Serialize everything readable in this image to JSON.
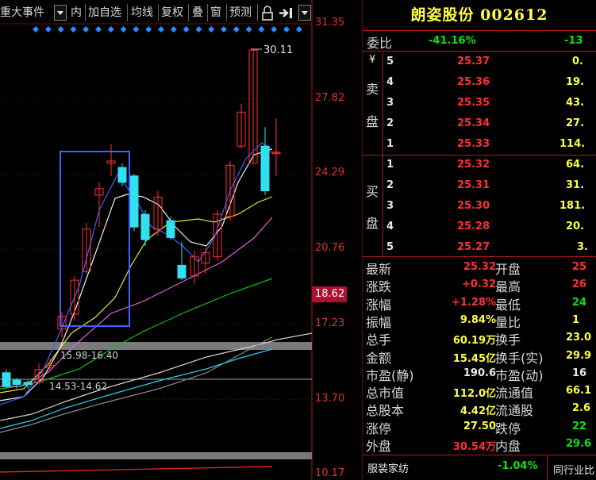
{
  "toolbar": {
    "items": [
      "重大事件",
      "内",
      "加自选",
      "均线",
      "复权",
      "叠",
      "窗",
      "预测"
    ]
  },
  "axis": {
    "price_labels": [
      "31.35",
      "27.82",
      "24.29",
      "20.76",
      "17.23",
      "13.70",
      "10.17"
    ],
    "current_price": "18.62",
    "high_annotation": "30.11",
    "gap_labels": [
      "15.98-16.40",
      "14.53-14.62"
    ]
  },
  "quote": {
    "title": "朗姿股份 002612",
    "weibi_label": "委比",
    "weibi_value": "-41.16%",
    "weicha_value": "-13",
    "sell_label": [
      "卖",
      "盘"
    ],
    "buy_label": [
      "买",
      "盘"
    ],
    "sell_symbol": "¥",
    "sell": [
      {
        "level": "5",
        "price": "25.37",
        "vol": "0."
      },
      {
        "level": "4",
        "price": "25.36",
        "vol": "19."
      },
      {
        "level": "3",
        "price": "25.35",
        "vol": "43."
      },
      {
        "level": "2",
        "price": "25.34",
        "vol": "27."
      },
      {
        "level": "1",
        "price": "25.33",
        "vol": "114."
      }
    ],
    "buy": [
      {
        "level": "1",
        "price": "25.32",
        "vol": "64."
      },
      {
        "level": "2",
        "price": "25.31",
        "vol": "31."
      },
      {
        "level": "3",
        "price": "25.30",
        "vol": "181."
      },
      {
        "level": "4",
        "price": "25.28",
        "vol": "20."
      },
      {
        "level": "5",
        "price": "25.27",
        "vol": "3."
      }
    ],
    "stats": [
      {
        "l1": "最新",
        "v1": "25.32",
        "l2": "开盘",
        "v2": "25",
        "c": "red"
      },
      {
        "l1": "涨跌",
        "v1": "+0.32",
        "l2": "最高",
        "v2": "26",
        "c": "red"
      },
      {
        "l1": "涨幅",
        "v1": "+1.28%",
        "l2": "最低",
        "v2": "24",
        "c": "red"
      },
      {
        "l1": "振幅",
        "v1": "9.84%",
        "l2": "量比",
        "v2": "1",
        "c": "yellow"
      },
      {
        "l1": "总手",
        "v1": "60.19万",
        "l2": "换手",
        "v2": "23.0",
        "c": "yellow"
      },
      {
        "l1": "金额",
        "v1": "15.45亿",
        "l2": "换手(实)",
        "v2": "29.9",
        "c": "yellow"
      },
      {
        "l1": "市盈(静)",
        "v1": "190.6",
        "l2": "市盈(动)",
        "v2": "16",
        "c": "white"
      },
      {
        "l1": "总市值",
        "v1": "112.0亿",
        "l2": "流通值",
        "v2": "66.1",
        "c": "yellow"
      },
      {
        "l1": "总股本",
        "v1": "4.42亿",
        "l2": "流通股",
        "v2": "2.6",
        "c": "yellow"
      },
      {
        "l1": "涨停",
        "v1": "27.50",
        "l2": "跌停",
        "v2": "22",
        "c": "yellow"
      },
      {
        "l1": "外盘",
        "v1": "30.54万",
        "l2": "内盘",
        "v2": "29.6",
        "c": "red"
      }
    ],
    "stat_colors_v2": [
      "red",
      "red",
      "green",
      "yellow",
      "yellow",
      "yellow",
      "white",
      "yellow",
      "yellow",
      "green",
      "green"
    ],
    "sector_label": "服装家纺",
    "sector_value": "-1.04%",
    "peer_label": "同行业比"
  },
  "colors": {
    "up": "#ff3030",
    "down": "#30e0f0",
    "panel_border": "#b01818",
    "title": "#ffff40"
  }
}
